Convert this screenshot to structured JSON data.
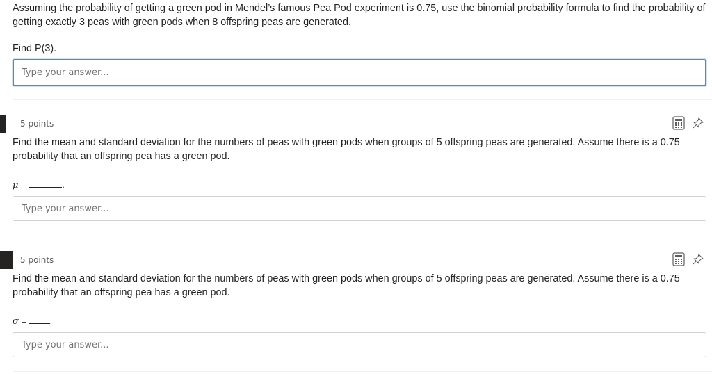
{
  "q1": {
    "prompt": "Assuming the probability of getting a green pod in Mendel’s famous Pea Pod experiment is 0.75, use the binomial probability formula to find the probability of getting exactly 3 peas with green pods when 8 offspring peas are generated.",
    "find_label": "Find P(3).",
    "answer_placeholder": "Type your answer..."
  },
  "q2": {
    "points": "5 points",
    "prompt": "Find the mean and standard deviation for the numbers of peas with green pods when groups of 5 offspring peas are generated. Assume there is a 0.75 probability that an offspring pea has a green pod.",
    "symbol": "μ",
    "equals": " =",
    "answer_placeholder": "Type your answer..."
  },
  "q3": {
    "points": "5 points",
    "prompt": "Find the mean and standard deviation for the numbers of peas with green pods when groups of 5 offspring peas are generated. Assume there is a 0.75 probability that an offspring pea has a green pod.",
    "symbol": "σ",
    "equals": " =",
    "answer_placeholder": "Type your answer..."
  },
  "colors": {
    "focus_border": "#4a90c8",
    "text": "#252423",
    "placeholder": "#8a8886"
  },
  "icons": [
    "calculator-icon",
    "pin-icon"
  ]
}
